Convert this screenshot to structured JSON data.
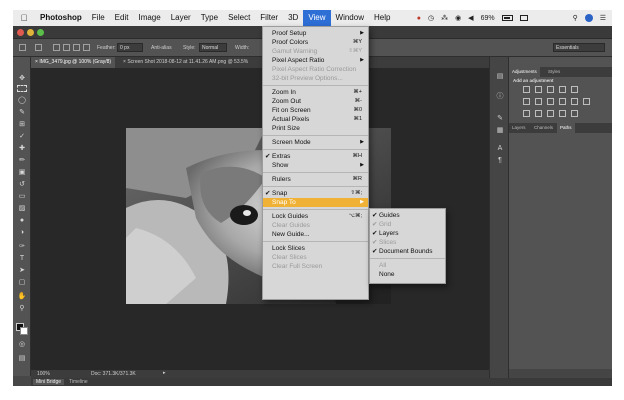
{
  "menubar": {
    "app": "Photoshop",
    "items": [
      "File",
      "Edit",
      "Image",
      "Layer",
      "Type",
      "Select",
      "Filter",
      "3D",
      "View",
      "Window",
      "Help"
    ],
    "active": "View",
    "status": {
      "battery": "69%"
    }
  },
  "options": {
    "feather_label": "Feather:",
    "feather_value": "0 px",
    "antialias_label": "Anti-alias",
    "style_label": "Style:",
    "style_value": "Normal",
    "width_label": "Width:",
    "workspace": "Essentials"
  },
  "tabs": [
    {
      "label": "IMG_3479.jpg @ 100% (Gray/8)"
    },
    {
      "label": "Screen Shot 2018-08-12 at 11.41.26 AM.png @ 53.5%"
    }
  ],
  "status": {
    "zoom": "100%",
    "doc": "Doc: 371.3K/371.3K"
  },
  "bottom_tabs": [
    "Mini Bridge",
    "Timeline"
  ],
  "panels": {
    "top_tabs": [
      "Adjustments",
      "Styles"
    ],
    "add_adjustment": "Add an adjustment",
    "bottom_tabs": [
      "Layers",
      "Channels",
      "Paths"
    ]
  },
  "view_menu": [
    {
      "label": "Proof Setup",
      "submenu": true
    },
    {
      "label": "Proof Colors",
      "shortcut": "⌘Y"
    },
    {
      "label": "Gamut Warning",
      "shortcut": "⇧⌘Y",
      "disabled": true
    },
    {
      "label": "Pixel Aspect Ratio",
      "submenu": true
    },
    {
      "label": "Pixel Aspect Ratio Correction",
      "disabled": true
    },
    {
      "label": "32-bit Preview Options...",
      "disabled": true
    },
    {
      "sep": true
    },
    {
      "label": "Zoom In",
      "shortcut": "⌘+"
    },
    {
      "label": "Zoom Out",
      "shortcut": "⌘-"
    },
    {
      "label": "Fit on Screen",
      "shortcut": "⌘0"
    },
    {
      "label": "Actual Pixels",
      "shortcut": "⌘1"
    },
    {
      "label": "Print Size"
    },
    {
      "sep": true
    },
    {
      "label": "Screen Mode",
      "submenu": true
    },
    {
      "sep": true
    },
    {
      "label": "Extras",
      "shortcut": "⌘H",
      "checked": true
    },
    {
      "label": "Show",
      "submenu": true
    },
    {
      "sep": true
    },
    {
      "label": "Rulers",
      "shortcut": "⌘R"
    },
    {
      "sep": true
    },
    {
      "label": "Snap",
      "shortcut": "⇧⌘;",
      "checked": true
    },
    {
      "label": "Snap To",
      "submenu": true,
      "highlighted": true
    },
    {
      "sep": true
    },
    {
      "label": "Lock Guides",
      "shortcut": "⌥⌘;"
    },
    {
      "label": "Clear Guides",
      "disabled": true
    },
    {
      "label": "New Guide..."
    },
    {
      "sep": true
    },
    {
      "label": "Lock Slices"
    },
    {
      "label": "Clear Slices",
      "disabled": true
    },
    {
      "label": "Clear Full Screen",
      "disabled": true
    }
  ],
  "snap_to_menu": [
    {
      "label": "Guides",
      "checked": true
    },
    {
      "label": "Grid",
      "disabled": true,
      "checked": true
    },
    {
      "label": "Layers",
      "checked": true
    },
    {
      "label": "Slices",
      "disabled": true,
      "checked": true
    },
    {
      "label": "Document Bounds",
      "checked": true
    },
    {
      "sep": true
    },
    {
      "label": "All",
      "disabled": true
    },
    {
      "label": "None"
    }
  ]
}
